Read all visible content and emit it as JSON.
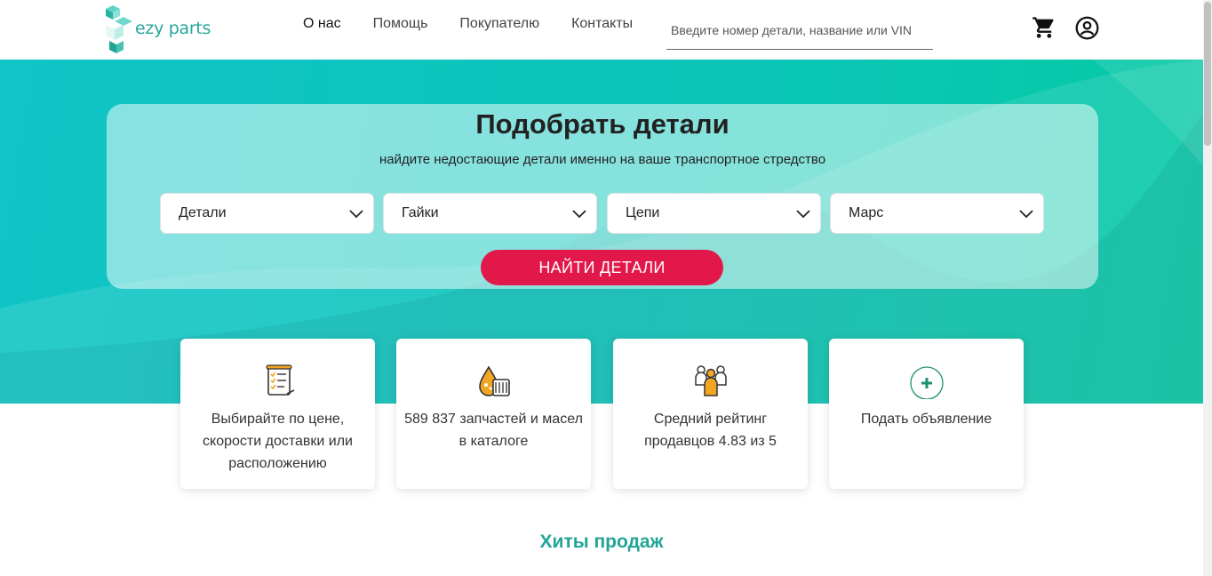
{
  "header": {
    "logo_text": "ezy parts",
    "nav": [
      {
        "label": "О нас",
        "active": true
      },
      {
        "label": "Помощь",
        "active": false
      },
      {
        "label": "Покупателю",
        "active": false
      },
      {
        "label": "Контакты",
        "active": false
      }
    ],
    "search_placeholder": "Введите номер детали, название или VIN",
    "cart_icon": "cart-icon",
    "user_icon": "account-circle-icon"
  },
  "hero": {
    "title": "Подобрать детали",
    "subtitle": "найдите недостающие детали именно на ваше транспортное стредство",
    "selects": [
      {
        "value": "Детали"
      },
      {
        "value": "Гайки"
      },
      {
        "value": "Цепи"
      },
      {
        "value": "Марс"
      }
    ],
    "button_label": "НАЙТИ ДЕТАЛИ"
  },
  "features": [
    {
      "icon": "checklist-document-icon",
      "text": "Выбирайте по цене, скорости доставки или расположению"
    },
    {
      "icon": "oil-filter-icon",
      "text": "589 837 запчастей и масел в каталоге"
    },
    {
      "icon": "sellers-group-icon",
      "text": "Средний рейтинг продавцов 4.83 из 5"
    },
    {
      "icon": "plus-circle-icon",
      "text": "Подать объявление"
    }
  ],
  "section_title": "Хиты продаж",
  "colors": {
    "brand": "#26a69a",
    "accent_button": "#e2174a",
    "hero_start": "#11c4c6",
    "hero_end": "#06c9a4",
    "section_title": "#22a597"
  }
}
